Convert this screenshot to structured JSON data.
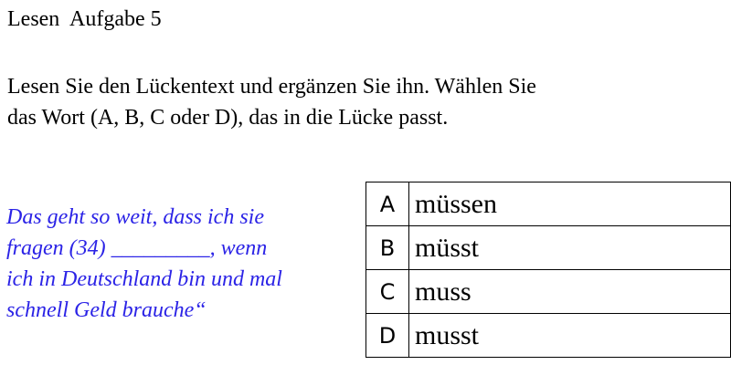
{
  "header": {
    "section": "Lesen",
    "task": "Aufgabe 5"
  },
  "instructions": {
    "line1": "Lesen Sie den Lückentext und ergänzen Sie ihn. Wählen Sie",
    "line2": "das Wort (A, B, C oder D), das in die Lücke passt."
  },
  "passage": {
    "lines": [
      "Das geht so weit, dass ich sie",
      "fragen (34) _________, wenn",
      "ich in Deutschland bin und mal",
      "schnell Geld brauche“"
    ],
    "color": "#2b23e6"
  },
  "options": [
    {
      "letter": "A",
      "word": "müssen"
    },
    {
      "letter": "B",
      "word": "müsst"
    },
    {
      "letter": "C",
      "word": "muss"
    },
    {
      "letter": "D",
      "word": "musst"
    }
  ]
}
